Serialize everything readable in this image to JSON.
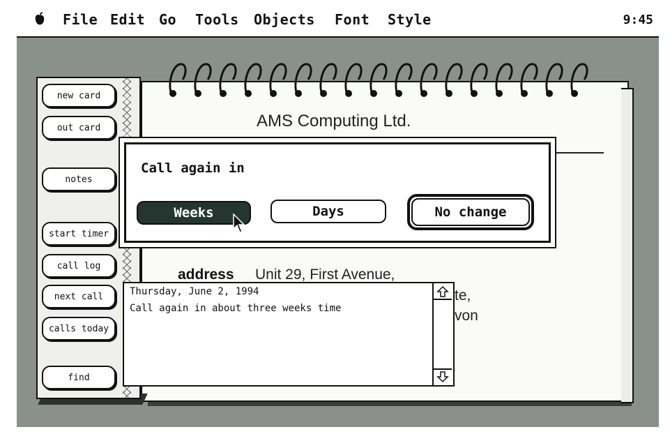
{
  "menubar": {
    "apple_icon": "apple-icon",
    "items": [
      "File",
      "Edit",
      "Go",
      "Tools",
      "Objects",
      "Font",
      "Style"
    ],
    "clock": "9:45"
  },
  "card": {
    "company": "AMS Computing Ltd.",
    "address_label": "address",
    "address_lines": [
      "Unit 29, First Avenue,",
      "te,",
      "von"
    ]
  },
  "sidebar": {
    "buttons": [
      "new card",
      "out card",
      "notes",
      "start timer",
      "call log",
      "next call",
      "calls today",
      "find"
    ]
  },
  "dialog": {
    "title": "Call again in",
    "buttons": [
      "Weeks",
      "Days",
      "No change"
    ],
    "selected": "Weeks",
    "default": "No change"
  },
  "notes_box": {
    "lines": [
      "Thursday, June 2, 1994",
      "Call again in about three weeks time"
    ]
  },
  "colors": {
    "desktop": "#8a918d",
    "selected_button": "#25352f"
  }
}
